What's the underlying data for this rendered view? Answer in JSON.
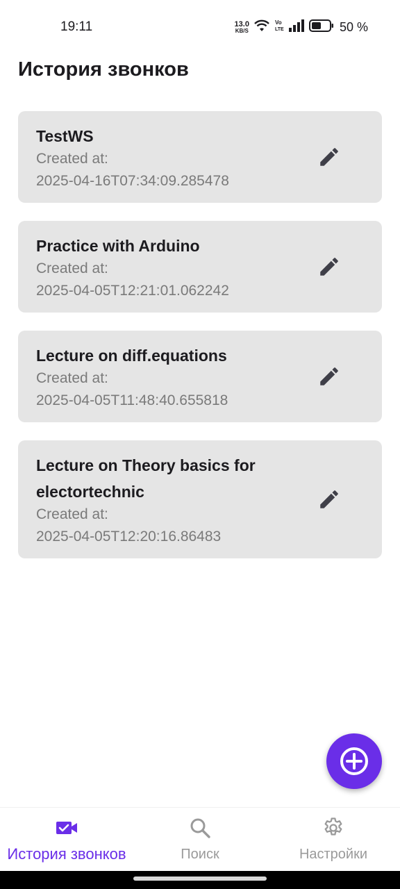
{
  "status_bar": {
    "time": "19:11",
    "net_speed_value": "13.0",
    "net_speed_unit": "KB/S",
    "volte": "Vo LTE",
    "battery_percent": "50 %"
  },
  "page": {
    "title": "История звонков"
  },
  "calls": [
    {
      "title": "TestWS",
      "created_label": "Created at:",
      "created_at": "2025-04-16T07:34:09.285478"
    },
    {
      "title": "Practice with Arduino",
      "created_label": "Created at:",
      "created_at": "2025-04-05T12:21:01.062242"
    },
    {
      "title": "Lecture on diff.equations",
      "created_label": "Created at:",
      "created_at": "2025-04-05T11:48:40.655818"
    },
    {
      "title": "Lecture on Theory basics for electortechnic",
      "created_label": "Created at:",
      "created_at": "2025-04-05T12:20:16.86483"
    }
  ],
  "icons": {
    "edit": "pencil-icon",
    "fab": "add-circle-icon",
    "nav_calls": "video-call-icon",
    "nav_search": "search-icon",
    "nav_settings": "gear-icon"
  },
  "bottom_nav": [
    {
      "label": "История звонков",
      "active": true
    },
    {
      "label": "Поиск",
      "active": false
    },
    {
      "label": "Настройки",
      "active": false
    }
  ],
  "colors": {
    "accent": "#6a2ee8",
    "card_bg": "#e5e5e5",
    "inactive": "#9a9a9a"
  }
}
